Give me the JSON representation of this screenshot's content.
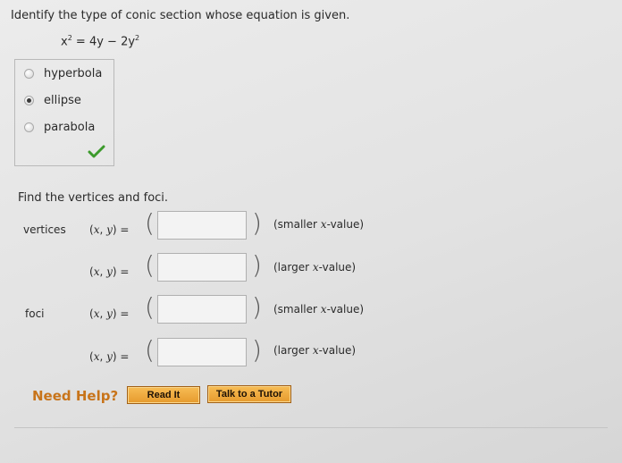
{
  "question": {
    "prompt": "Identify the type of conic section whose equation is given.",
    "equation_lhs": "x",
    "equation_lhs_exp": "2",
    "equation_mid": " = 4y − 2y",
    "equation_rhs_exp": "2"
  },
  "choices": [
    {
      "label": "hyperbola",
      "selected": false
    },
    {
      "label": "ellipse",
      "selected": true
    },
    {
      "label": "parabola",
      "selected": false
    }
  ],
  "correct_mark": "check-icon",
  "vertices_foci": {
    "title": "Find the vertices and foci.",
    "vertices_label": "vertices",
    "foci_label": "foci",
    "xy_label": "(x, y) =",
    "open_paren": "(",
    "close_paren": ")",
    "rows": [
      {
        "hint": "(smaller x-value)",
        "value": ""
      },
      {
        "hint": "(larger x-value)",
        "value": ""
      },
      {
        "hint": "(smaller x-value)",
        "value": ""
      },
      {
        "hint": "(larger x-value)",
        "value": ""
      }
    ]
  },
  "help": {
    "need_help": "Need Help?",
    "read_it": "Read It",
    "talk_to_tutor": "Talk to a Tutor"
  },
  "colors": {
    "accent": "#c8741a",
    "check": "#3c9a2c",
    "button": "#e69a2d"
  }
}
